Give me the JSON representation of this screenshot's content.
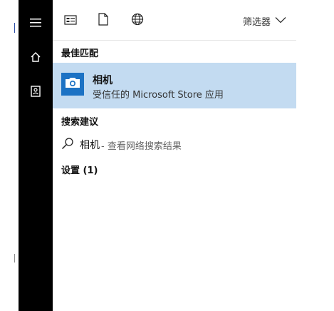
{
  "rail": {
    "menu_icon": "hamburger-menu-icon",
    "home_icon": "home-icon",
    "account_icon": "contact-card-icon"
  },
  "topbar": {
    "apps_icon": "apps-icon",
    "documents_icon": "document-icon",
    "web_icon": "globe-icon",
    "filter_label": "筛选器",
    "filter_icon": "chevron-down-icon"
  },
  "sections": {
    "best_match": "最佳匹配",
    "search_suggestions": "搜索建议",
    "settings": "设置 (1)"
  },
  "best_match": {
    "app_name": "相机",
    "app_subtitle": "受信任的 Microsoft Store 应用",
    "icon": "camera-icon",
    "highlight_color": "#c3dbf1",
    "icon_bg_color": "#1c72c4"
  },
  "suggestion": {
    "icon": "search-icon",
    "term": "相机",
    "hint": "- 查看网络搜索结果"
  },
  "colors": {
    "rail_bg": "#000000",
    "panel_bg": "#ffffff"
  }
}
